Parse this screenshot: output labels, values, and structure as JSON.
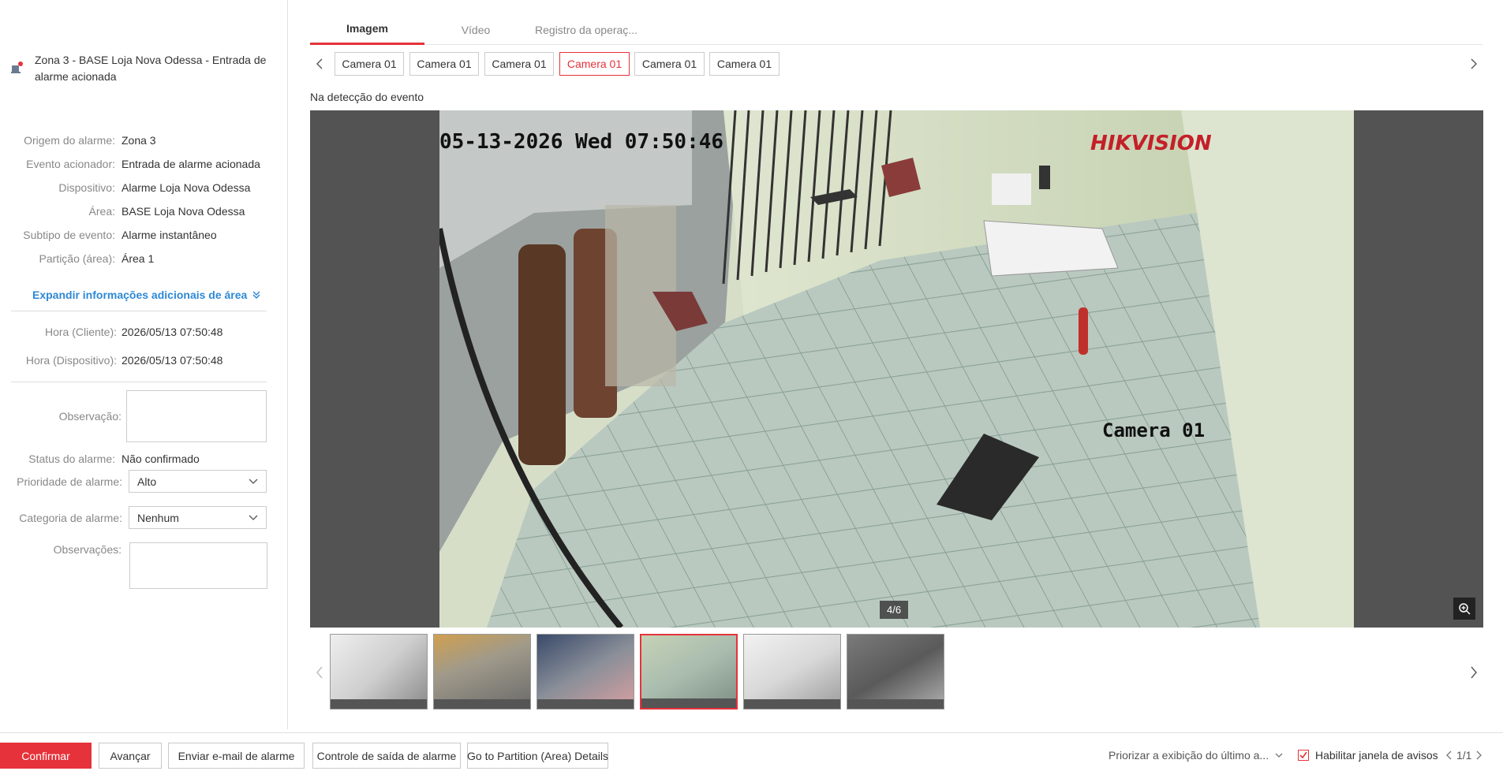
{
  "alarm": {
    "title": "Zona 3 - BASE Loja Nova Odessa - Entrada de alarme acionada",
    "info": [
      {
        "label": "Origem do alarme:",
        "value": "Zona 3"
      },
      {
        "label": "Evento acionador:",
        "value": "Entrada de alarme acionada"
      },
      {
        "label": "Dispositivo:",
        "value": "Alarme Loja Nova Odessa"
      },
      {
        "label": "Área:",
        "value": "BASE Loja Nova Odessa"
      },
      {
        "label": "Subtipo de evento:",
        "value": "Alarme instantâneo"
      },
      {
        "label": "Partição (área):",
        "value": "Área 1"
      }
    ],
    "expand_label": "Expandir informações adicionais de área",
    "client_time_label": "Hora (Cliente):",
    "client_time": "2026/05/13 07:50:48",
    "device_time_label": "Hora (Dispositivo):",
    "device_time": "2026/05/13 07:50:48",
    "observation_label": "Observação:",
    "status_label": "Status do alarme:",
    "status_value": "Não confirmado",
    "priority_label": "Prioridade de alarme:",
    "priority_value": "Alto",
    "category_label": "Categoria de alarme:",
    "category_value": "Nenhum",
    "remarks_label": "Observações:"
  },
  "tabs": [
    {
      "label": "Imagem",
      "active": true
    },
    {
      "label": "Vídeo",
      "active": false
    },
    {
      "label": "Registro da operaç...",
      "active": false
    }
  ],
  "cameras": [
    {
      "label": "Camera 01",
      "active": false
    },
    {
      "label": "Camera 01",
      "active": false
    },
    {
      "label": "Camera 01",
      "active": false
    },
    {
      "label": "Camera 01",
      "active": true
    },
    {
      "label": "Camera 01",
      "active": false
    },
    {
      "label": "Camera 01",
      "active": false
    }
  ],
  "event_label": "Na detecção do evento",
  "viewer": {
    "timestamp": "05-13-2026 Wed 07:50:46",
    "brand": "HIKVISION",
    "camera_name": "Camera 01",
    "counter": "4/6"
  },
  "thumbnails": [
    {
      "active": false
    },
    {
      "active": false
    },
    {
      "active": false
    },
    {
      "active": true
    },
    {
      "active": false
    },
    {
      "active": false
    }
  ],
  "actions": {
    "confirm": "Confirmar",
    "advance": "Avançar",
    "email": "Enviar e-mail de alarme",
    "output": "Controle de saída de alarme",
    "partition": "Go to Partition (Area) Details"
  },
  "footer": {
    "prioritize": "Priorizar a exibição do último a...",
    "enable_popup": "Habilitar janela de avisos",
    "enable_popup_checked": true,
    "page": "1/1"
  },
  "colors": {
    "accent": "#e6323a",
    "link": "#2e88d5"
  }
}
